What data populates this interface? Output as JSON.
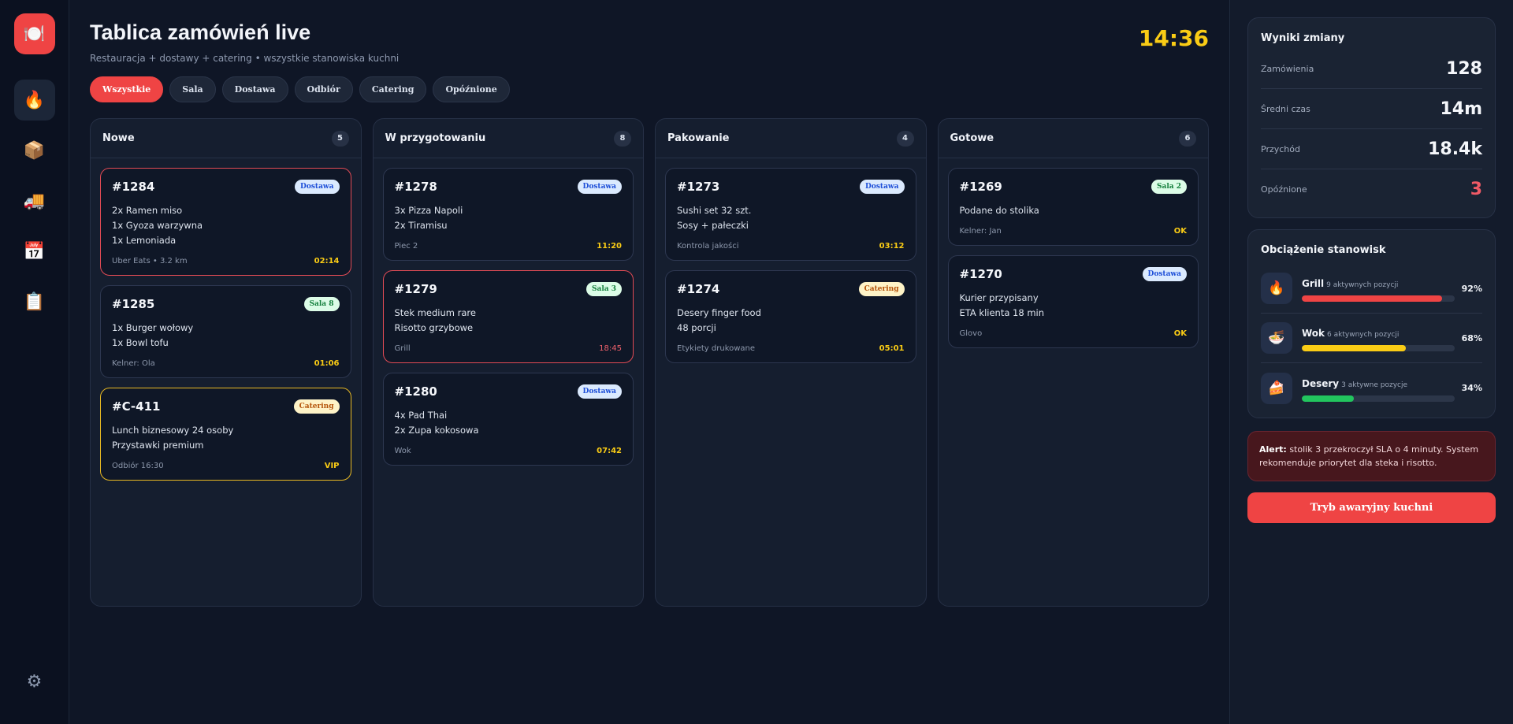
{
  "app": {
    "title": "Tablica zamówień live",
    "subtitle": "Restauracja + dostawy + catering • wszystkie stanowiska kuchni",
    "clock": "14:36"
  },
  "sidebar": {
    "logo_icon": "🍽️",
    "items": [
      {
        "name": "fire",
        "icon": "🔥"
      },
      {
        "name": "box",
        "icon": "📦"
      },
      {
        "name": "truck",
        "icon": "🚚"
      },
      {
        "name": "calendar",
        "icon": "📅"
      },
      {
        "name": "clipboard",
        "icon": "📋"
      }
    ],
    "settings_icon": "⚙"
  },
  "filters": [
    "Wszystkie",
    "Sala",
    "Dostawa",
    "Odbiór",
    "Catering",
    "Opóźnione"
  ],
  "columns": [
    {
      "title": "Nowe",
      "count": "5",
      "cards": [
        {
          "id": "#1284",
          "badge": "Dostawa",
          "items": [
            "2x Ramen miso",
            "1x Gyoza warzywna",
            "1x Lemoniada"
          ],
          "note": "Uber Eats • 3.2 km",
          "time": "02:14"
        },
        {
          "id": "#1285",
          "badge": "Sala 8",
          "items": [
            "1x Burger wołowy",
            "1x Bowl tofu"
          ],
          "note": "Kelner: Ola",
          "time": "01:06"
        },
        {
          "id": "#C-411",
          "badge": "Catering",
          "items": [
            "Lunch biznesowy 24 osoby",
            "Przystawki premium"
          ],
          "note": "Odbiór 16:30",
          "time": "VIP"
        }
      ]
    },
    {
      "title": "W przygotowaniu",
      "count": "8",
      "cards": [
        {
          "id": "#1278",
          "badge": "Dostawa",
          "items": [
            "3x Pizza Napoli",
            "2x Tiramisu"
          ],
          "note": "Piec 2",
          "time": "11:20"
        },
        {
          "id": "#1279",
          "badge": "Sala 3",
          "items": [
            "Stek medium rare",
            "Risotto grzybowe"
          ],
          "note": "Grill",
          "time": "18:45"
        },
        {
          "id": "#1280",
          "badge": "Dostawa",
          "items": [
            "4x Pad Thai",
            "2x Zupa kokosowa"
          ],
          "note": "Wok",
          "time": "07:42"
        }
      ]
    },
    {
      "title": "Pakowanie",
      "count": "4",
      "cards": [
        {
          "id": "#1273",
          "badge": "Dostawa",
          "items": [
            "Sushi set 32 szt.",
            "Sosy + pałeczki"
          ],
          "note": "Kontrola jakości",
          "time": "03:12"
        },
        {
          "id": "#1274",
          "badge": "Catering",
          "items": [
            "Desery finger food",
            "48 porcji"
          ],
          "note": "Etykiety drukowane",
          "time": "05:01"
        }
      ]
    },
    {
      "title": "Gotowe",
      "count": "6",
      "cards": [
        {
          "id": "#1269",
          "badge": "Sala 2",
          "items": [
            "Podane do stolika"
          ],
          "note": "Kelner: Jan",
          "time": "OK"
        },
        {
          "id": "#1270",
          "badge": "Dostawa",
          "items": [
            "Kurier przypisany",
            "ETA klienta 18 min"
          ],
          "note": "Glovo",
          "time": "OK"
        }
      ]
    }
  ],
  "results": {
    "title": "Wyniki zmiany",
    "rows": [
      {
        "label": "Zamówienia",
        "value": "128"
      },
      {
        "label": "Średni czas",
        "value": "14m"
      },
      {
        "label": "Przychód",
        "value": "18.4k"
      },
      {
        "label": "Opóźnione",
        "value": "3"
      }
    ]
  },
  "stations": {
    "title": "Obciążenie stanowisk",
    "items": [
      {
        "name": "Grill",
        "sub": "9 aktywnych pozycji",
        "pct": "92%",
        "load": 0.92,
        "icon": "🔥",
        "color": "#ef4444"
      },
      {
        "name": "Wok",
        "sub": "6 aktywnych pozycji",
        "pct": "68%",
        "load": 0.68,
        "icon": "🍜",
        "color": "#facc15"
      },
      {
        "name": "Desery",
        "sub": "3 aktywne pozycje",
        "pct": "34%",
        "load": 0.34,
        "icon": "🍰",
        "color": "#22c55e"
      }
    ]
  },
  "alert": {
    "label": "Alert:",
    "text": " stolik 3 przekroczył SLA o 4 minuty. System rekomenduje priorytet dla steka i risotto."
  },
  "emergency_button": "Tryb awaryjny kuchni"
}
